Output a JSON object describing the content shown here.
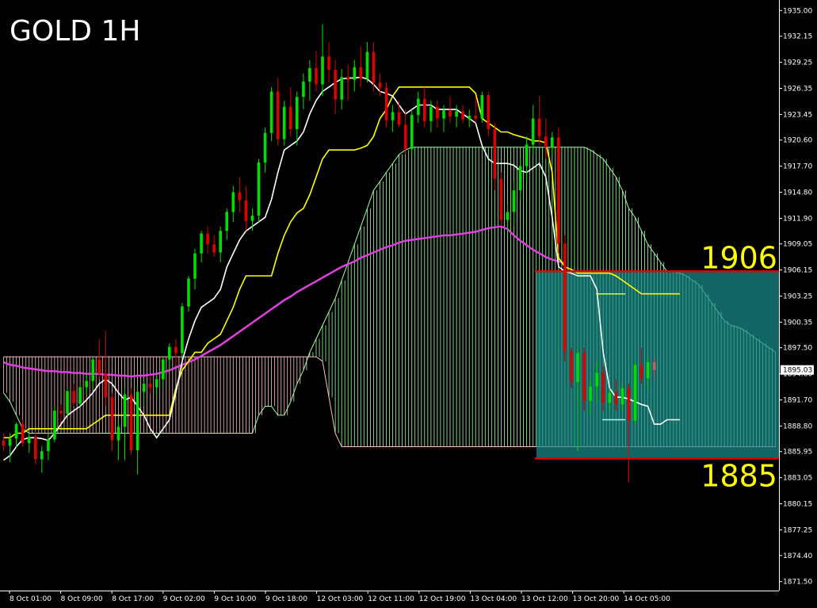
{
  "chart_data": {
    "type": "candlestick",
    "title": "GOLD 1H",
    "ylim": [
      1870.5,
      1936.0
    ],
    "y_ticks": [
      "1935.00",
      "1932.15",
      "1929.25",
      "1926.35",
      "1923.45",
      "1920.60",
      "1917.70",
      "1914.80",
      "1911.90",
      "1909.05",
      "1906.15",
      "1903.25",
      "1900.35",
      "1897.50",
      "1894.60",
      "1891.70",
      "1888.80",
      "1885.95",
      "1883.05",
      "1880.15",
      "1877.25",
      "1874.40",
      "1871.50"
    ],
    "x_ticks": [
      "8 Oct 01:00",
      "8 Oct 09:00",
      "8 Oct 17:00",
      "9 Oct 02:00",
      "9 Oct 10:00",
      "9 Oct 18:00",
      "12 Oct 03:00",
      "12 Oct 11:00",
      "12 Oct 19:00",
      "13 Oct 04:00",
      "13 Oct 12:00",
      "13 Oct 20:00",
      "14 Oct 05:00"
    ],
    "current_price": "1895.03",
    "levels": [
      {
        "label": "1906",
        "value": 1906.0
      },
      {
        "label": "1885",
        "value": 1885.2
      }
    ],
    "colors": {
      "background": "#000000",
      "bull": "#00e000",
      "bear": "#e00000",
      "last_bear": "#c06060",
      "tenkan": "#ffffff",
      "kijun": "#ffff00",
      "ma": "#e040e0",
      "cloud_span_a": "#a0ffa0",
      "cloud_span_b": "#ffc0c0",
      "zone_fill": "#1a8c8c",
      "level_line": "#e00000",
      "level_text": "#ffff00",
      "axis_text": "#ffffff",
      "axis_line": "#ffffff",
      "kijun_projection": "#ccff66",
      "tenkan_projection": "#aaffff"
    },
    "candles": [
      [
        1887.2,
        1888.0,
        1886.0,
        1886.6
      ],
      [
        1886.6,
        1888.0,
        1884.8,
        1887.4
      ],
      [
        1887.4,
        1889.2,
        1886.4,
        1889.0
      ],
      [
        1889.0,
        1889.5,
        1886.5,
        1886.9
      ],
      [
        1886.9,
        1888.0,
        1885.8,
        1887.6
      ],
      [
        1887.6,
        1888.2,
        1884.5,
        1885.1
      ],
      [
        1885.1,
        1886.6,
        1883.6,
        1886.0
      ],
      [
        1886.0,
        1888.0,
        1885.0,
        1887.3
      ],
      [
        1887.3,
        1891.0,
        1887.0,
        1890.5
      ],
      [
        1890.5,
        1891.2,
        1889.3,
        1890.2
      ],
      [
        1890.2,
        1893.0,
        1890.0,
        1892.7
      ],
      [
        1892.7,
        1893.5,
        1891.0,
        1891.3
      ],
      [
        1891.3,
        1893.5,
        1891.0,
        1893.1
      ],
      [
        1893.1,
        1894.5,
        1892.3,
        1893.8
      ],
      [
        1893.8,
        1896.5,
        1893.0,
        1896.2
      ],
      [
        1896.2,
        1898.5,
        1894.0,
        1894.6
      ],
      [
        1894.6,
        1899.3,
        1891.0,
        1892.0
      ],
      [
        1892.0,
        1892.5,
        1886.0,
        1887.2
      ],
      [
        1887.2,
        1889.5,
        1885.0,
        1888.7
      ],
      [
        1888.7,
        1893.0,
        1885.0,
        1892.3
      ],
      [
        1892.3,
        1893.0,
        1885.6,
        1886.1
      ],
      [
        1886.1,
        1893.4,
        1883.4,
        1892.6
      ],
      [
        1892.6,
        1894.0,
        1891.0,
        1893.5
      ],
      [
        1893.5,
        1894.5,
        1892.4,
        1893.1
      ],
      [
        1893.1,
        1894.5,
        1892.0,
        1894.0
      ],
      [
        1894.0,
        1896.5,
        1893.0,
        1896.2
      ],
      [
        1896.2,
        1898.0,
        1895.0,
        1897.6
      ],
      [
        1897.6,
        1898.5,
        1895.5,
        1896.9
      ],
      [
        1896.9,
        1902.5,
        1896.5,
        1902.1
      ],
      [
        1902.1,
        1905.5,
        1901.5,
        1905.2
      ],
      [
        1905.2,
        1908.5,
        1904.0,
        1908.0
      ],
      [
        1908.0,
        1910.5,
        1907.0,
        1910.2
      ],
      [
        1910.2,
        1911.0,
        1908.0,
        1909.0
      ],
      [
        1909.0,
        1910.0,
        1907.6,
        1908.1
      ],
      [
        1908.1,
        1911.0,
        1907.0,
        1910.5
      ],
      [
        1910.5,
        1913.0,
        1909.5,
        1912.6
      ],
      [
        1912.6,
        1915.5,
        1911.5,
        1914.8
      ],
      [
        1914.8,
        1916.5,
        1912.5,
        1913.9
      ],
      [
        1913.9,
        1915.5,
        1910.5,
        1911.6
      ],
      [
        1911.6,
        1913.0,
        1910.5,
        1912.2
      ],
      [
        1912.2,
        1918.5,
        1911.5,
        1918.1
      ],
      [
        1918.1,
        1922.0,
        1917.0,
        1921.4
      ],
      [
        1921.4,
        1926.5,
        1920.5,
        1926.0
      ],
      [
        1926.0,
        1927.5,
        1920.0,
        1920.7
      ],
      [
        1920.7,
        1925.0,
        1920.0,
        1924.3
      ],
      [
        1924.3,
        1926.5,
        1921.0,
        1921.8
      ],
      [
        1921.8,
        1926.0,
        1920.0,
        1925.4
      ],
      [
        1925.4,
        1928.0,
        1924.0,
        1927.1
      ],
      [
        1927.1,
        1929.5,
        1925.0,
        1928.6
      ],
      [
        1928.6,
        1930.5,
        1926.0,
        1926.8
      ],
      [
        1926.8,
        1933.5,
        1925.5,
        1929.9
      ],
      [
        1929.9,
        1931.5,
        1927.0,
        1928.4
      ],
      [
        1928.4,
        1929.5,
        1923.5,
        1925.1
      ],
      [
        1925.1,
        1928.5,
        1924.0,
        1927.6
      ],
      [
        1927.6,
        1929.0,
        1925.0,
        1927.3
      ],
      [
        1927.3,
        1929.5,
        1926.0,
        1928.7
      ],
      [
        1928.7,
        1931.0,
        1926.5,
        1927.4
      ],
      [
        1927.4,
        1931.5,
        1927.0,
        1930.4
      ],
      [
        1930.4,
        1931.5,
        1926.0,
        1927.0
      ],
      [
        1927.0,
        1928.0,
        1925.5,
        1926.4
      ],
      [
        1926.4,
        1927.0,
        1922.0,
        1922.8
      ],
      [
        1922.8,
        1924.5,
        1921.5,
        1923.7
      ],
      [
        1923.7,
        1925.0,
        1922.0,
        1922.3
      ],
      [
        1922.3,
        1924.0,
        1919.0,
        1919.6
      ],
      [
        1919.6,
        1924.0,
        1919.0,
        1923.4
      ],
      [
        1923.4,
        1926.0,
        1922.5,
        1925.2
      ],
      [
        1925.2,
        1926.5,
        1922.0,
        1922.7
      ],
      [
        1922.7,
        1925.0,
        1921.5,
        1924.3
      ],
      [
        1924.3,
        1925.0,
        1922.0,
        1923.0
      ],
      [
        1923.0,
        1924.5,
        1921.5,
        1923.9
      ],
      [
        1923.9,
        1925.5,
        1922.5,
        1923.2
      ],
      [
        1923.2,
        1924.5,
        1922.0,
        1923.8
      ],
      [
        1923.8,
        1924.5,
        1922.5,
        1922.9
      ],
      [
        1922.9,
        1924.0,
        1922.0,
        1923.3
      ],
      [
        1923.3,
        1925.5,
        1922.5,
        1923.0
      ],
      [
        1923.0,
        1926.0,
        1922.5,
        1925.6
      ],
      [
        1925.6,
        1926.0,
        1921.0,
        1921.8
      ],
      [
        1921.8,
        1922.5,
        1915.0,
        1916.3
      ],
      [
        1916.3,
        1917.0,
        1911.0,
        1911.7
      ],
      [
        1911.7,
        1913.5,
        1910.5,
        1912.6
      ],
      [
        1912.6,
        1916.0,
        1911.0,
        1915.0
      ],
      [
        1915.0,
        1918.5,
        1914.0,
        1917.7
      ],
      [
        1917.7,
        1921.0,
        1916.0,
        1920.1
      ],
      [
        1920.1,
        1924.5,
        1919.0,
        1923.0
      ],
      [
        1923.0,
        1925.5,
        1920.0,
        1921.0
      ],
      [
        1921.0,
        1923.0,
        1918.5,
        1919.8
      ],
      [
        1919.8,
        1921.5,
        1919.0,
        1920.9
      ],
      [
        1920.9,
        1922.0,
        1908.0,
        1909.1
      ],
      [
        1909.1,
        1910.0,
        1896.0,
        1897.1
      ],
      [
        1897.1,
        1897.5,
        1893.0,
        1893.7
      ],
      [
        1893.7,
        1897.5,
        1886.0,
        1896.9
      ],
      [
        1896.9,
        1897.5,
        1890.5,
        1891.6
      ],
      [
        1891.6,
        1894.0,
        1890.0,
        1893.2
      ],
      [
        1893.2,
        1896.0,
        1891.5,
        1894.7
      ],
      [
        1894.7,
        1895.5,
        1890.5,
        1891.4
      ],
      [
        1891.4,
        1893.0,
        1890.5,
        1892.5
      ],
      [
        1892.5,
        1894.0,
        1890.5,
        1891.2
      ],
      [
        1891.2,
        1893.5,
        1890.5,
        1893.0
      ],
      [
        1893.0,
        1893.5,
        1882.5,
        1889.4
      ],
      [
        1889.4,
        1896.0,
        1889.0,
        1895.6
      ],
      [
        1895.6,
        1897.5,
        1893.5,
        1894.1
      ],
      [
        1894.1,
        1896.5,
        1893.0,
        1895.9
      ],
      [
        1895.9,
        1896.5,
        1894.0,
        1895.03
      ]
    ],
    "ma": [
      1895.9,
      1895.6,
      1895.5,
      1895.3,
      1895.2,
      1895.1,
      1895.0,
      1894.9,
      1894.9,
      1894.8,
      1894.8,
      1894.7,
      1894.7,
      1894.6,
      1894.6,
      1894.6,
      1894.5,
      1894.5,
      1894.4,
      1894.4,
      1894.3,
      1894.4,
      1894.4,
      1894.5,
      1894.6,
      1894.8,
      1895.0,
      1895.3,
      1895.6,
      1895.9,
      1896.2,
      1896.6,
      1897.0,
      1897.4,
      1897.8,
      1898.3,
      1898.8,
      1899.3,
      1899.8,
      1900.3,
      1900.8,
      1901.3,
      1901.8,
      1902.3,
      1902.8,
      1903.2,
      1903.7,
      1904.1,
      1904.5,
      1904.9,
      1905.3,
      1905.7,
      1906.1,
      1906.5,
      1906.8,
      1907.1,
      1907.5,
      1907.8,
      1908.1,
      1908.4,
      1908.7,
      1908.9,
      1909.2,
      1909.4,
      1909.5,
      1909.6,
      1909.7,
      1909.8,
      1909.9,
      1910.0,
      1910.0,
      1910.1,
      1910.2,
      1910.3,
      1910.4,
      1910.6,
      1910.8,
      1910.9,
      1911.0,
      1910.7,
      1910.0,
      1909.4,
      1908.9,
      1908.4,
      1908.0,
      1907.6,
      1907.3,
      1907.1,
      1906.9
    ],
    "tenkan": [
      1885.0,
      1885.5,
      1886.5,
      1887.3,
      1887.5,
      1887.5,
      1887.4,
      1887.2,
      1888.0,
      1889.0,
      1890.0,
      1890.5,
      1891.0,
      1891.7,
      1892.5,
      1893.5,
      1894.0,
      1893.5,
      1892.5,
      1891.7,
      1892.0,
      1891.0,
      1890.0,
      1888.5,
      1887.5,
      1888.5,
      1889.5,
      1892.5,
      1896.0,
      1898.5,
      1900.5,
      1902.0,
      1902.5,
      1903.0,
      1904.0,
      1906.5,
      1908.0,
      1909.5,
      1910.5,
      1911.0,
      1911.5,
      1912.0,
      1914.0,
      1917.0,
      1919.5,
      1920.0,
      1920.5,
      1921.5,
      1923.5,
      1925.0,
      1926.0,
      1926.5,
      1927.0,
      1927.4,
      1927.5,
      1927.5,
      1927.6,
      1927.4,
      1926.8,
      1926.0,
      1925.8,
      1925.5,
      1924.5,
      1923.5,
      1924.0,
      1924.5,
      1924.5,
      1924.5,
      1924.0,
      1924.0,
      1924.0,
      1924.0,
      1923.5,
      1923.0,
      1922.5,
      1920.0,
      1918.5,
      1918.0,
      1918.0,
      1918.0,
      1917.8,
      1917.2,
      1917.0,
      1917.5,
      1918.0,
      1916.5,
      1912.0,
      1906.5,
      1906.0,
      1905.8,
      1905.5,
      1905.5,
      1905.5,
      1904.0,
      1897.0,
      1893.0,
      1892.0,
      1892.0,
      1891.8,
      1891.5,
      1891.2,
      1891.0,
      1889.0,
      1889.0,
      1889.5,
      1889.5,
      1889.5
    ],
    "kijun": [
      1887.5,
      1887.5,
      1888.0,
      1888.0,
      1888.5,
      1888.5,
      1888.5,
      1888.5,
      1888.5,
      1888.5,
      1888.5,
      1888.5,
      1888.5,
      1888.5,
      1889.0,
      1889.5,
      1890.0,
      1890.0,
      1890.0,
      1890.0,
      1890.0,
      1890.0,
      1890.0,
      1890.0,
      1890.0,
      1890.0,
      1890.0,
      1893.0,
      1895.0,
      1896.0,
      1897.0,
      1897.0,
      1898.0,
      1898.5,
      1899.0,
      1900.5,
      1902.0,
      1904.0,
      1905.5,
      1905.5,
      1905.5,
      1905.5,
      1905.5,
      1908.0,
      1910.0,
      1911.5,
      1912.5,
      1913.0,
      1914.5,
      1916.5,
      1918.5,
      1919.5,
      1919.5,
      1919.5,
      1919.5,
      1919.5,
      1919.7,
      1920.0,
      1921.0,
      1923.0,
      1924.0,
      1925.5,
      1926.5,
      1926.5,
      1926.5,
      1926.5,
      1926.5,
      1926.5,
      1926.5,
      1926.5,
      1926.5,
      1926.5,
      1926.5,
      1926.5,
      1925.8,
      1923.0,
      1922.5,
      1922.0,
      1921.5,
      1921.5,
      1921.2,
      1921.0,
      1920.8,
      1920.5,
      1920.5,
      1920.3,
      1917.0,
      1907.5,
      1906.5,
      1906.2,
      1905.8,
      1905.8,
      1905.8,
      1905.8,
      1905.8,
      1905.8,
      1905.5,
      1905.0,
      1904.5,
      1904.0,
      1903.5,
      1903.5,
      1903.5,
      1903.5,
      1903.5,
      1903.5,
      1903.5
    ],
    "cloud_offset": 0,
    "span_a": [
      1892.5,
      1891.5,
      1890.0,
      1888.5,
      1888.0,
      1888.0,
      1888.0,
      1888.0,
      1888.0,
      1888.0,
      1888.0,
      1888.0,
      1888.0,
      1888.0,
      1888.0,
      1888.0,
      1888.0,
      1888.0,
      1888.0,
      1888.0,
      1888.0,
      1888.0,
      1888.0,
      1888.0,
      1888.0,
      1888.0,
      1888.0,
      1888.0,
      1888.0,
      1888.0,
      1888.0,
      1888.0,
      1888.0,
      1888.0,
      1888.0,
      1888.0,
      1888.0,
      1888.0,
      1888.0,
      1888.0,
      1890.0,
      1891.0,
      1891.0,
      1890.0,
      1890.0,
      1891.5,
      1893.5,
      1895.0,
      1897.0,
      1898.5,
      1900.0,
      1901.5,
      1903.0,
      1905.0,
      1907.0,
      1909.0,
      1911.0,
      1913.0,
      1915.0,
      1916.0,
      1917.0,
      1918.0,
      1919.0,
      1919.5,
      1919.8,
      1919.8,
      1919.8,
      1919.8,
      1919.8,
      1919.8,
      1919.8,
      1919.8,
      1919.8,
      1919.8,
      1919.8,
      1919.8,
      1919.8,
      1919.8,
      1919.8,
      1919.8,
      1919.8,
      1919.8,
      1919.8,
      1919.8,
      1919.8,
      1919.8,
      1919.8,
      1919.8,
      1919.8,
      1919.8,
      1919.8,
      1919.8,
      1919.5,
      1919.0,
      1918.5,
      1917.5,
      1916.5,
      1915.0,
      1913.0,
      1912.0,
      1910.5,
      1909.0,
      1908.0,
      1907.0,
      1906.0,
      1906.0,
      1905.8,
      1905.5,
      1905.0,
      1904.5,
      1903.5,
      1902.5,
      1901.5,
      1900.5,
      1900.0,
      1899.8,
      1899.5,
      1899.0,
      1898.5,
      1898.0,
      1897.5,
      1897.0,
      1896.5,
      1896.5,
      1896.0,
      1896.0,
      1896.0,
      1896.0,
      1896.0,
      1896.0,
      1896.0,
      1896.0
    ],
    "span_b": [
      1896.5,
      1896.5,
      1896.5,
      1896.5,
      1896.5,
      1896.5,
      1896.5,
      1896.5,
      1896.5,
      1896.5,
      1896.5,
      1896.5,
      1896.5,
      1896.5,
      1896.5,
      1896.5,
      1896.5,
      1896.5,
      1896.5,
      1896.5,
      1896.5,
      1896.5,
      1896.5,
      1896.5,
      1896.5,
      1896.5,
      1896.5,
      1896.5,
      1896.5,
      1896.5,
      1896.5,
      1896.5,
      1896.5,
      1896.5,
      1896.5,
      1896.5,
      1896.5,
      1896.5,
      1896.5,
      1896.5,
      1896.5,
      1896.5,
      1896.5,
      1896.5,
      1896.5,
      1896.5,
      1896.5,
      1896.5,
      1896.5,
      1896.5,
      1896.0,
      1892.0,
      1888.0,
      1886.5,
      1886.5,
      1886.5,
      1886.5,
      1886.5,
      1886.5,
      1886.5,
      1886.5,
      1886.5,
      1886.5,
      1886.5,
      1886.5,
      1886.5,
      1886.5,
      1886.5,
      1886.5,
      1886.5,
      1886.5,
      1886.5,
      1886.5,
      1886.5,
      1886.5,
      1886.5,
      1886.5,
      1886.5,
      1886.5,
      1886.5,
      1886.5,
      1886.5,
      1886.5,
      1886.5,
      1886.5,
      1886.5,
      1886.5,
      1886.5,
      1886.5,
      1886.5,
      1886.5,
      1886.5,
      1886.5,
      1886.5,
      1886.5,
      1886.5,
      1886.5,
      1886.5,
      1886.5,
      1886.5,
      1886.5,
      1886.5,
      1886.5,
      1886.5,
      1886.5,
      1886.5,
      1886.5,
      1886.5,
      1886.5,
      1886.5,
      1886.5,
      1886.5,
      1886.5,
      1886.5,
      1886.5,
      1886.5,
      1886.5,
      1886.5,
      1886.5,
      1886.5,
      1886.5,
      1886.5,
      1886.5,
      1886.5,
      1886.5,
      1886.5,
      1886.5,
      1886.5,
      1886.5,
      1886.5,
      1886.5,
      1886.5
    ]
  }
}
